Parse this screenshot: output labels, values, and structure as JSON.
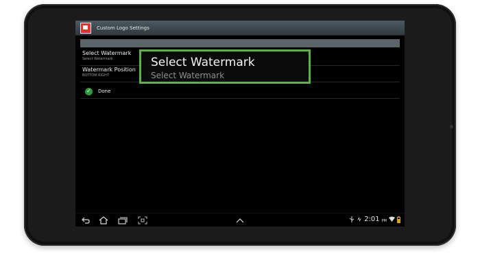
{
  "window": {
    "title": "Custom Logo Settings",
    "app_icon": "custom-logo-app-icon"
  },
  "preferences": [
    {
      "title": "Select Watermark",
      "summary": "Select Watermark"
    },
    {
      "title": "Watermark Position",
      "summary": "BOTTOM RIGHT"
    }
  ],
  "done": {
    "label": "Done",
    "icon": "check-circle-icon"
  },
  "callout": {
    "title": "Select Watermark",
    "summary": "Select Watermark"
  },
  "navbar": {
    "buttons": [
      "back-icon",
      "home-icon",
      "recent-apps-icon",
      "screenshot-icon"
    ],
    "menu_icon": "chevron-up-icon"
  },
  "status": {
    "time": "2:01",
    "ampm": "PM",
    "icons": [
      "usb-icon",
      "sync-icon",
      "wifi-icon",
      "battery-icon"
    ]
  },
  "colors": {
    "highlight": "#5cb346",
    "check": "#2e9b3a",
    "titlebar": "#3d4950"
  }
}
